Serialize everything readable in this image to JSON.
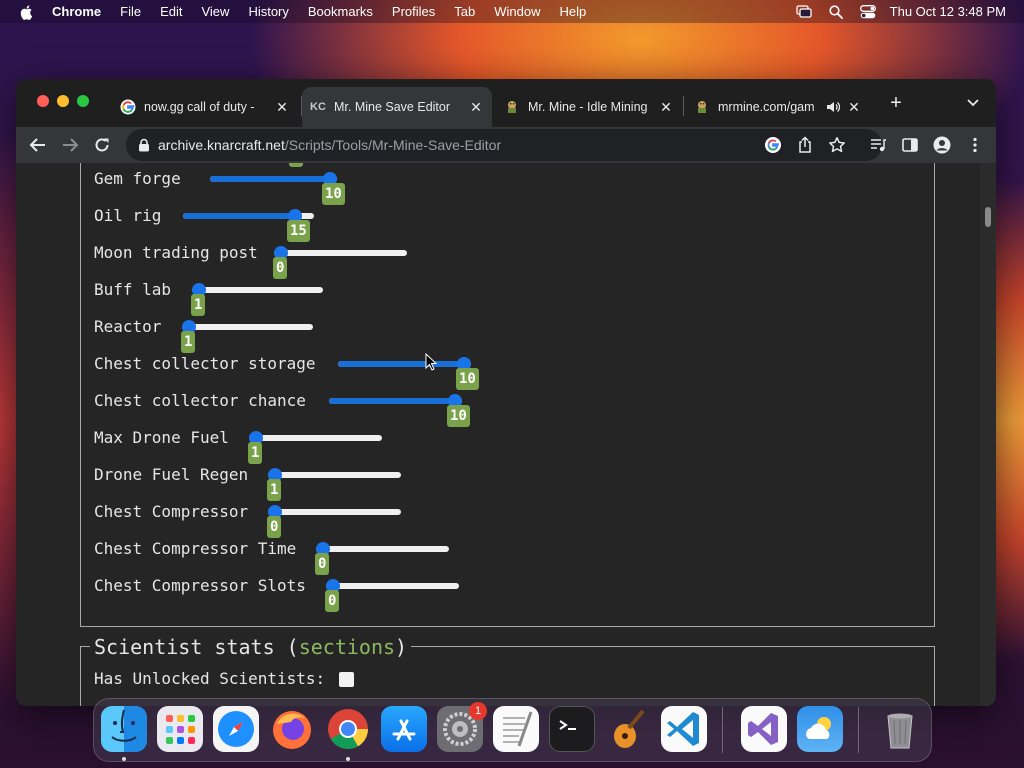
{
  "menubar": {
    "app": "Chrome",
    "items": [
      "File",
      "Edit",
      "View",
      "History",
      "Bookmarks",
      "Profiles",
      "Tab",
      "Window",
      "Help"
    ],
    "clock": "Thu Oct 12  3:48 PM"
  },
  "tabs": [
    {
      "title": "now.gg call of duty - ",
      "icon": "google-icon",
      "active": false
    },
    {
      "title": "Mr. Mine Save Editor",
      "icon": "kc-favicon",
      "active": true
    },
    {
      "title": "Mr. Mine - Idle Mining",
      "icon": "mrmine-favicon",
      "active": false
    },
    {
      "title": "mrmine.com/gam",
      "icon": "mrmine-favicon",
      "active": false,
      "audio": true
    }
  ],
  "tab_favicon_kc": "KC",
  "address": {
    "host": "archive.knarcraft.net",
    "path": "/Scripts/Tools/Mr-Mine-Save-Editor"
  },
  "sliders": [
    {
      "label": "Gem forge",
      "value": "10",
      "fraction": 1.0
    },
    {
      "label": "Oil rig",
      "value": "15",
      "fraction": 0.9
    },
    {
      "label": "Moon trading post",
      "value": "0",
      "fraction": 0.0
    },
    {
      "label": "Buff lab",
      "value": "1",
      "fraction": 0.0
    },
    {
      "label": "Reactor",
      "value": "1",
      "fraction": 0.0
    },
    {
      "label": "Chest collector storage",
      "value": "10",
      "fraction": 1.0
    },
    {
      "label": "Chest collector chance",
      "value": "10",
      "fraction": 1.0
    },
    {
      "label": "Max Drone Fuel",
      "value": "1",
      "fraction": 0.0
    },
    {
      "label": "Drone Fuel Regen",
      "value": "1",
      "fraction": 0.0
    },
    {
      "label": "Chest Compressor",
      "value": "0",
      "fraction": 0.0
    },
    {
      "label": "Chest Compressor Time",
      "value": "0",
      "fraction": 0.0
    },
    {
      "label": "Chest Compressor Slots",
      "value": "0",
      "fraction": 0.0
    }
  ],
  "scientist": {
    "legend_title": "Scientist stats (",
    "legend_link": "sections",
    "legend_close": ")",
    "unlocked_label": "Has Unlocked Scientists:",
    "unlocked_checked": false
  },
  "dock": {
    "apps": [
      "finder-icon",
      "launchpad-icon",
      "safari-icon",
      "firefox-icon",
      "chrome-icon",
      "app-store-icon",
      "system-settings-icon",
      "textedit-icon",
      "terminal-icon",
      "garageband-icon",
      "vscode-icon",
      "visual-studio-icon",
      "weather-icon",
      "trash-icon"
    ],
    "settings_badge": "1"
  },
  "colors": {
    "accent": "#1a73e8",
    "badge": "#7aa24a",
    "section_link": "#8cb860"
  }
}
